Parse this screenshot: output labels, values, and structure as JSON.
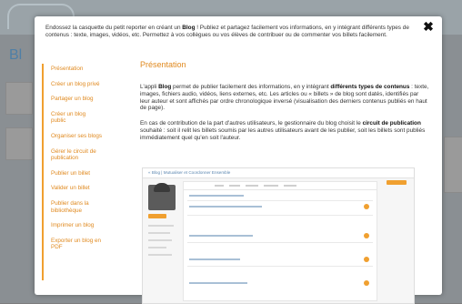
{
  "modal": {
    "close_label": "✖",
    "intro_parts": [
      "Endossez la casquette du petit reporter en créant un ",
      "Blog",
      " ! Publiez et partagez facilement vos informations, en y intégrant différents types de contenus : texte, images, vidéos, etc. Permettez à vos collègues ou vos élèves de contribuer ou de commenter vos billets facilement."
    ]
  },
  "sidebar": {
    "items": [
      "Présentation",
      "Créer un blog privé",
      "Partager un blog",
      "Créer un blog public",
      "Organiser ses blogs",
      "Gérer le circuit de publication",
      "Publier un billet",
      "Valider un billet",
      "Publier dans la bibliothèque",
      "Imprimer un blog",
      "Exporter un blog en PDF"
    ]
  },
  "content": {
    "heading": "Présentation",
    "p1": {
      "a": "L'appli ",
      "b": "Blog",
      "c": " permet de publier facilement des informations, en y intégrant ",
      "d": "différents types de contenus",
      "e": " : texte, images, fichiers audio, vidéos, liens externes, etc. Les articles ou « billets » de blog sont datés, identifiés par leur auteur et sont affichés par ordre chronologique inversé (visualisation des derniers contenus publiés en haut de page)."
    },
    "p2": {
      "a": "En cas de contribution de la part d'autres utilisateurs, le gestionnaire du blog choisit le ",
      "b": "circuit de publication",
      "c": " souhaité : soit il relit les billets soumis par les autres utilisateurs avant de les publier, soit les billets sont publiés immédiatement quel qu'en soit l'auteur."
    },
    "screenshot": {
      "breadcrumb": "« Blog | Mutualiser et Coordonner Ensemble"
    }
  },
  "colors": {
    "accent": "#e08a20",
    "accent_bar": "#f0a030",
    "link": "#5a86b0",
    "text": "#333333"
  }
}
